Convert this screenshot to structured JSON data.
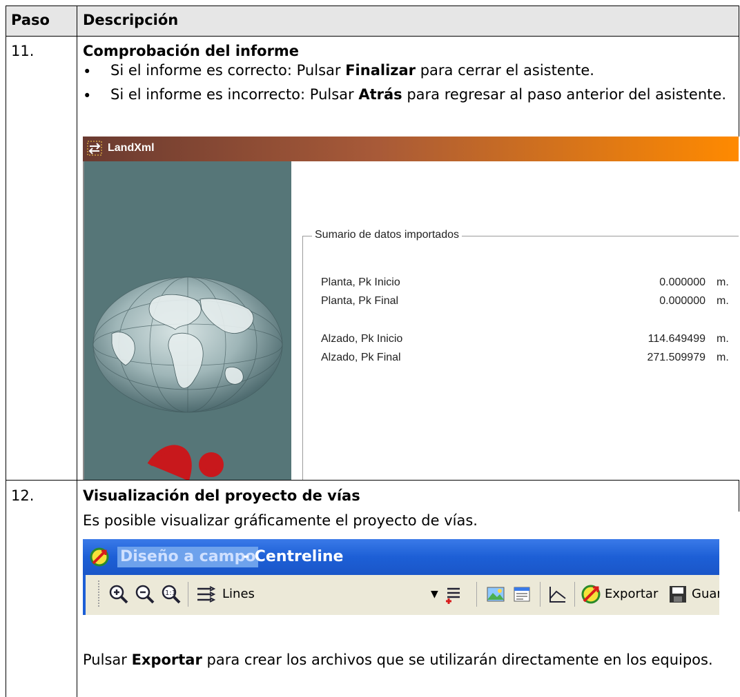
{
  "table": {
    "header": {
      "step": "Paso",
      "description": "Descripción"
    },
    "rows": [
      {
        "step": "11.",
        "title": "Comprobación del informe",
        "bullets": [
          {
            "pre": "Si el informe es correcto: Pulsar ",
            "bold": "Finalizar",
            "post": " para cerrar el asistente."
          },
          {
            "pre": "Si el informe es incorrecto: Pulsar ",
            "bold": "Atrás",
            "post": " para regresar al paso anterior del asistente."
          }
        ]
      },
      {
        "step": "12.",
        "title": "Visualización del proyecto de vías",
        "intro": "Es posible visualizar gráficamente el proyecto de vías.",
        "outro": {
          "pre": "Pulsar ",
          "bold": "Exportar",
          "post": " para crear los archivos que se utilizarán directamente en los equipos."
        }
      }
    ]
  },
  "landxml_dialog": {
    "title": "LandXml",
    "icon": "landxml-app-icon",
    "group_label": "Sumario de datos importados",
    "rows": [
      {
        "label": "Planta, Pk Inicio",
        "value": "0.000000",
        "unit": "m."
      },
      {
        "label": "Planta, Pk Final",
        "value": "0.000000",
        "unit": "m."
      },
      {
        "label": "Alzado, Pk Inicio",
        "value": "114.649499",
        "unit": "m."
      },
      {
        "label": "Alzado, Pk Final",
        "value": "271.509979",
        "unit": "m."
      }
    ],
    "colors": {
      "title_start": "#6a3a30",
      "title_end": "#ff8a00",
      "side_panel": "#567678"
    }
  },
  "centreline_window": {
    "title_highlight": "Diseño a campo",
    "title_rest": "- Centreline",
    "app_icon": "no-entry-arrow-icon",
    "toolbar": {
      "zoom_icons": [
        "zoom-in-icon",
        "zoom-out-icon",
        "zoom-extents-icon"
      ],
      "layers_icon": "layers-icon",
      "layer_select_value": "Lines",
      "export_label": "Exportar",
      "save_label": "Guar"
    },
    "colors": {
      "titlebar": "#1d5fd6",
      "toolbar": "#ece9d8"
    }
  }
}
